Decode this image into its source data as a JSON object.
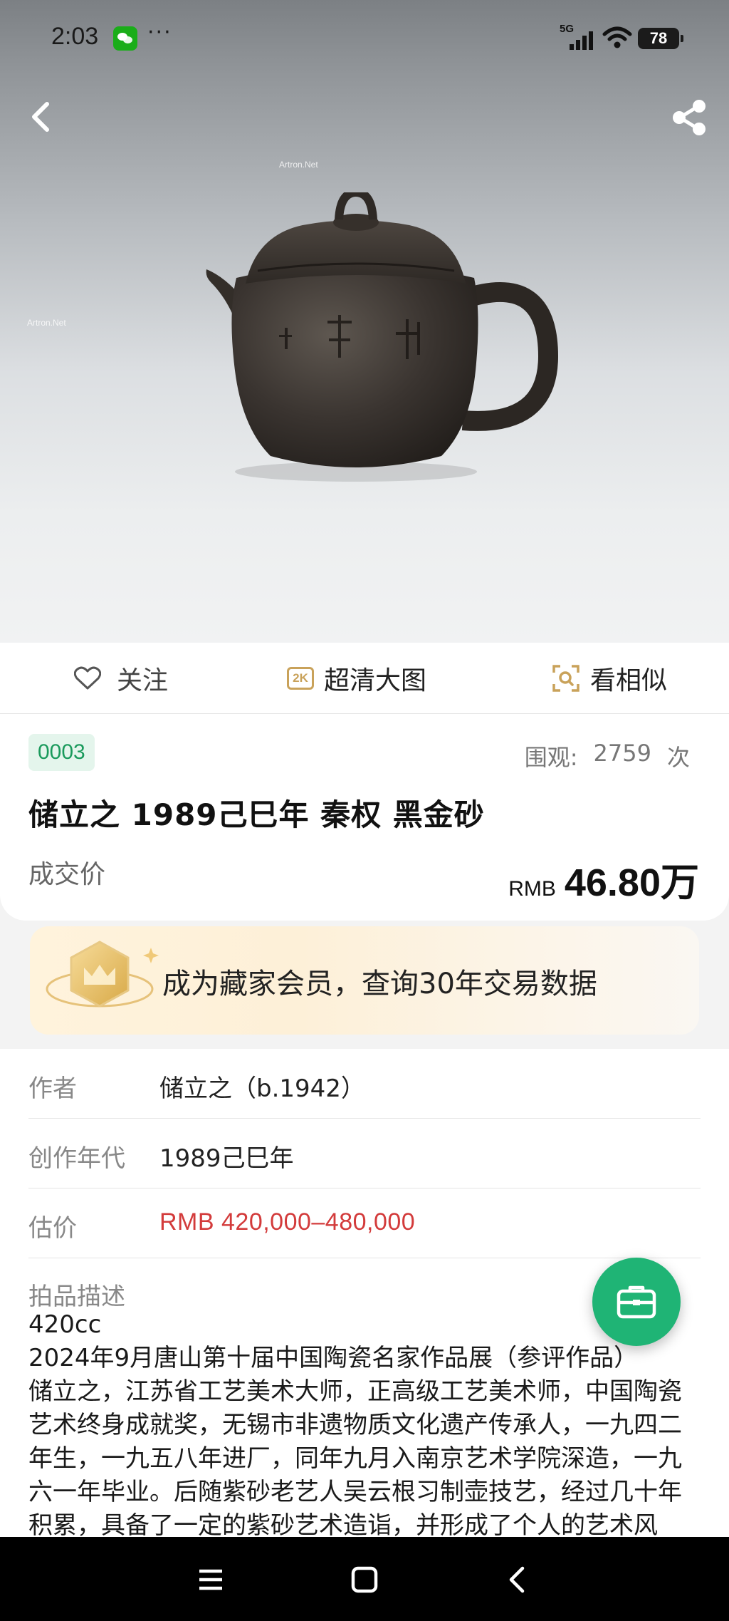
{
  "status_bar": {
    "time": "2:03",
    "dots": "···",
    "network": "5G",
    "battery": "78"
  },
  "hero": {
    "watermark": "Artron.Net"
  },
  "actions": {
    "follow": "关注",
    "hd_badge": "2K",
    "hd_view": "超清大图",
    "similar": "看相似"
  },
  "lot": {
    "number": "0003",
    "views_label": "围观:",
    "views_count": "2759",
    "views_unit": "次",
    "title": "储立之 1989己巳年 秦权 黑金砂",
    "deal_label": "成交价",
    "currency": "RMB",
    "price": "46.80万"
  },
  "member": {
    "text": "成为藏家会员，查询30年交易数据"
  },
  "details": {
    "author_label": "作者",
    "author_value": "储立之（b.1942）",
    "year_label": "创作年代",
    "year_value": "1989己巳年",
    "estimate_label": "估价",
    "estimate_value": "RMB  420,000–480,000",
    "desc_label": "拍品描述",
    "desc_lines": [
      "420cc",
      "2024年9月唐山第十届中国陶瓷名家作品展（参评作品）",
      "储立之，江苏省工艺美术大师，正高级工艺美术师，中国陶瓷",
      "艺术终身成就奖，无锡市非遗物质文化遗产传承人，一九四二",
      "年生，一九五八年进厂，同年九月入南京艺术学院深造，一九",
      "六一年毕业。后随紫砂老艺人吴云根习制壶技艺，经过几十年",
      "积累，具备了一定的紫砂艺术造诣，并形成了个人的艺术风"
    ]
  },
  "colors": {
    "accent_green": "#1fb475",
    "estimate_red": "#d33b3b",
    "hd_gold": "#c9a25a"
  }
}
